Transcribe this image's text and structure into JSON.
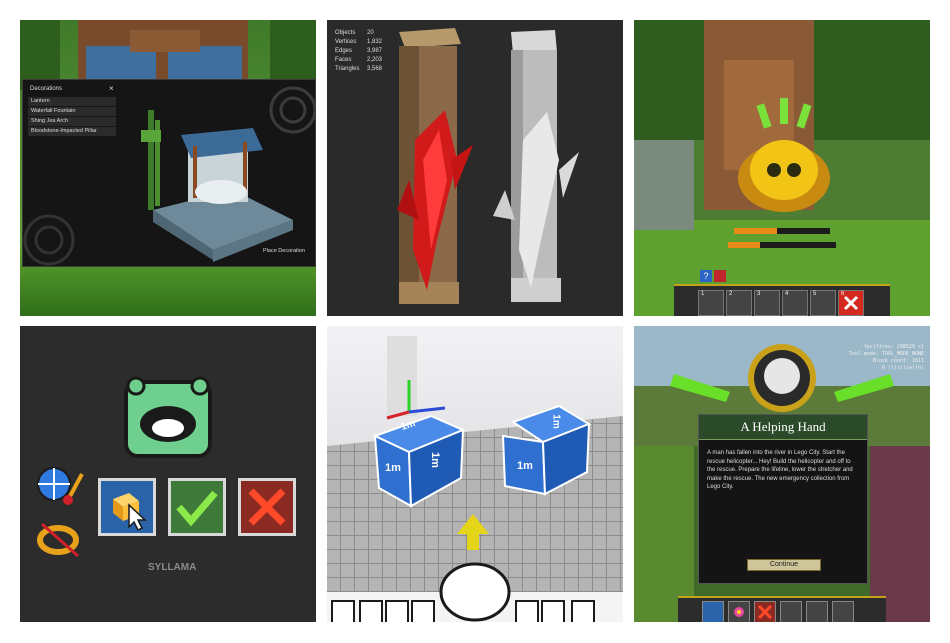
{
  "decorations_panel": {
    "title": "Decorations",
    "close_glyph": "×",
    "items": [
      "Lantern",
      "Waterfall Fountain",
      "Shing Jea Arch",
      "Bloodstone-Impacted Pillar"
    ],
    "place_button": "Place Decoration"
  },
  "mesh_stats": [
    {
      "label": "Objects",
      "value": "20"
    },
    {
      "label": "Vertices",
      "value": "1,832"
    },
    {
      "label": "Edges",
      "value": "3,987"
    },
    {
      "label": "Faces",
      "value": "2,203"
    },
    {
      "label": "Triangles",
      "value": "3,568"
    }
  ],
  "hotbar_top": {
    "slot_numbers": [
      "1",
      "2",
      "3",
      "4",
      "5",
      "6"
    ],
    "help_badge": "?"
  },
  "editor_tools": {
    "logo": "SYLLAMA"
  },
  "cube_labels": {
    "left_face": "1m",
    "left_side": "1m",
    "left_top": "1m",
    "right_face": "1m",
    "right_top": "1m"
  },
  "quest": {
    "debug_lines": [
      "fps[fires: 298529 s]",
      "Tool mode: TOOL_MODE_NONE",
      "Block count: 1611",
      "0 (t)(c)(w)(h)"
    ],
    "title": "A Helping Hand",
    "body": "A man has fallen into the river in Lego City. Start the rescue helicopter... Hey! Build the helicopter and off to the rescue. Prepare the lifeline, lower the stretcher and make the rescue. The new emergency collection from Lego City.",
    "continue": "Continue"
  }
}
